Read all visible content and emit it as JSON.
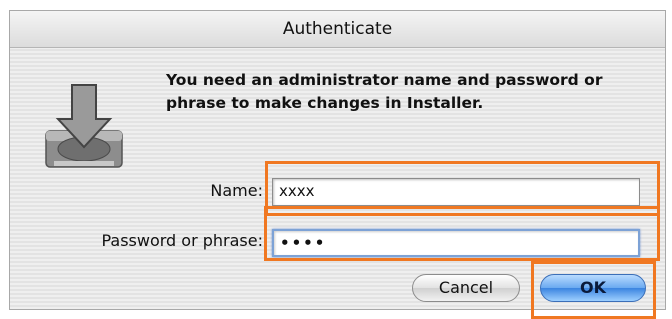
{
  "dialog": {
    "title": "Authenticate",
    "message": "You need an administrator name and password or phrase to make changes in Installer.",
    "icon": "installer-disk-download-icon"
  },
  "form": {
    "name_label": "Name:",
    "name_value": "xxxx",
    "password_label": "Password or phrase:",
    "password_value": "••••"
  },
  "buttons": {
    "cancel_label": "Cancel",
    "ok_label": "OK"
  },
  "colors": {
    "highlight": "#f07822",
    "default_button": "#3b84e0"
  }
}
